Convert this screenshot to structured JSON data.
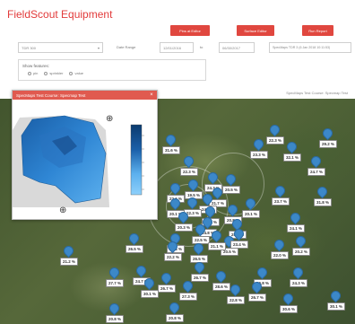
{
  "app": {
    "title": "FieldScout Equipment"
  },
  "buttons": {
    "pins_label": "Pins at Editor",
    "surface_label": "Surface Editor",
    "report_label": "Run Report"
  },
  "filters": {
    "sensor_value": "TDR 300",
    "date_range_label": "Date Range",
    "date_from": "12/01/2016",
    "to_label": "to",
    "date_to": "06/30/2017",
    "dataset_value": "SpecMaps TDR 3 (6 Jan 2018 10:11:53)"
  },
  "features": {
    "title": "Show features:",
    "options": [
      "pin",
      "sprinkler",
      "value"
    ]
  },
  "map": {
    "label": "SpecMaps Test Course: Specmap Test",
    "values": [
      "31.6 %",
      "22.3 %",
      "29.2 %",
      "23.3 %",
      "32.1 %",
      "24.7 %",
      "22.3 %",
      "22.8 %",
      "24.3 %",
      "20.5 %",
      "19.5 %",
      "22.6 %",
      "21.7 %",
      "24.3 %",
      "22.3 %",
      "20.1 %",
      "23.7 %",
      "31.8 %",
      "21.7 %",
      "20.1 %",
      "20.8 %",
      "21.7 %",
      "20.3 %",
      "24.8 %",
      "25.2 %",
      "22.5 %",
      "19.8 %",
      "26.5 %",
      "20.5 %",
      "22.2 %",
      "26.5 %",
      "21.1 %",
      "23.4 %",
      "24.1 %",
      "22.0 %",
      "20.2 %",
      "21.2 %",
      "26.7 %",
      "24.7 %",
      "27.7 %",
      "26.7 %",
      "30.1 %",
      "27.3 %",
      "20.8 %",
      "28.6 %",
      "22.8 %",
      "26.7 %",
      "24.3 %",
      "30.6 %",
      "20.8 %",
      "20.8 %",
      "30.1 %"
    ]
  },
  "panel": {
    "title": "SpecMaps Test Course: Specmap Test",
    "close": "×",
    "move_icon": "⊕",
    "colors": [
      "#0b3a6e",
      "#1a5fa8",
      "#2f86d4",
      "#5cb0ee",
      "#8ed0fb"
    ]
  }
}
